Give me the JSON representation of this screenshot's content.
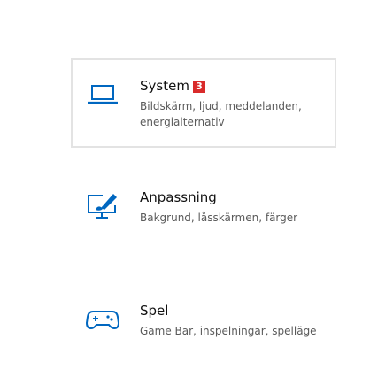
{
  "settings": {
    "items": [
      {
        "title": "System",
        "badge": "3",
        "description": "Bildskärm, ljud, meddelanden, energialternativ",
        "icon": "laptop-icon"
      },
      {
        "title": "Anpassning",
        "description": "Bakgrund, låsskärmen, färger",
        "icon": "paint-brush-monitor-icon"
      },
      {
        "title": "Spel",
        "description": "Game Bar, inspelningar, spelläge",
        "icon": "gamepad-icon"
      }
    ]
  },
  "colors": {
    "accent": "#0067c0",
    "badge": "#d92b2b",
    "selected_border": "#e3e3e3"
  }
}
